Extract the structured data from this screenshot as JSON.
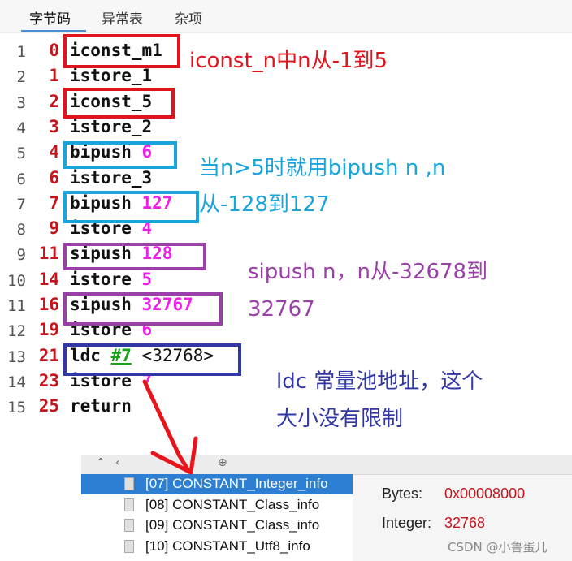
{
  "tabs": [
    "字节码",
    "异常表",
    "杂项"
  ],
  "code": [
    {
      "line": "1",
      "offset": "0",
      "op": "iconst_m1",
      "arg": "",
      "comment": ""
    },
    {
      "line": "2",
      "offset": "1",
      "op": "istore_1",
      "arg": "",
      "comment": ""
    },
    {
      "line": "3",
      "offset": "2",
      "op": "iconst_5",
      "arg": "",
      "comment": ""
    },
    {
      "line": "4",
      "offset": "3",
      "op": "istore_2",
      "arg": "",
      "comment": ""
    },
    {
      "line": "5",
      "offset": "4",
      "op": "bipush",
      "arg": "6",
      "comment": ""
    },
    {
      "line": "6",
      "offset": "6",
      "op": "istore_3",
      "arg": "",
      "comment": ""
    },
    {
      "line": "7",
      "offset": "7",
      "op": "bipush",
      "arg": "127",
      "comment": ""
    },
    {
      "line": "8",
      "offset": "9",
      "op": "istore",
      "arg": "4",
      "comment": ""
    },
    {
      "line": "9",
      "offset": "11",
      "op": "sipush",
      "arg": "128",
      "comment": ""
    },
    {
      "line": "10",
      "offset": "14",
      "op": "istore",
      "arg": "5",
      "comment": ""
    },
    {
      "line": "11",
      "offset": "16",
      "op": "sipush",
      "arg": "32767",
      "comment": ""
    },
    {
      "line": "12",
      "offset": "19",
      "op": "istore",
      "arg": "6",
      "comment": ""
    },
    {
      "line": "13",
      "offset": "21",
      "op": "ldc",
      "arg": "#7",
      "comment": "<32768>"
    },
    {
      "line": "14",
      "offset": "23",
      "op": "istore",
      "arg": "7",
      "comment": ""
    },
    {
      "line": "15",
      "offset": "25",
      "op": "return",
      "arg": "",
      "comment": ""
    }
  ],
  "annotations": {
    "iconst": "iconst_n中n从-1到5",
    "bipush_1": "当n>5时就用bipush n ,n",
    "bipush_2": "从-128到127",
    "sipush_1": "sipush n，n从-32678到",
    "sipush_2": "32767",
    "ldc_1": "ldc 常量池地址，这个",
    "ldc_2": "大小没有限制"
  },
  "constant_pool": {
    "items": [
      {
        "label": "[07] CONSTANT_Integer_info",
        "selected": true
      },
      {
        "label": "[08] CONSTANT_Class_info",
        "selected": false
      },
      {
        "label": "[09] CONSTANT_Class_info",
        "selected": false
      },
      {
        "label": "[10] CONSTANT_Utf8_info",
        "selected": false
      }
    ],
    "props": {
      "bytes_label": "Bytes:",
      "bytes_value": "0x00008000",
      "integer_label": "Integer:",
      "integer_value": "32768"
    }
  },
  "watermark": "CSDN @小鲁蛋儿",
  "colors": {
    "red": "#e0141d",
    "blue": "#19a4dc",
    "purple": "#9b40a9",
    "navy": "#3237a6",
    "arg": "#ee1ee9",
    "selection": "#2d7fd3"
  }
}
